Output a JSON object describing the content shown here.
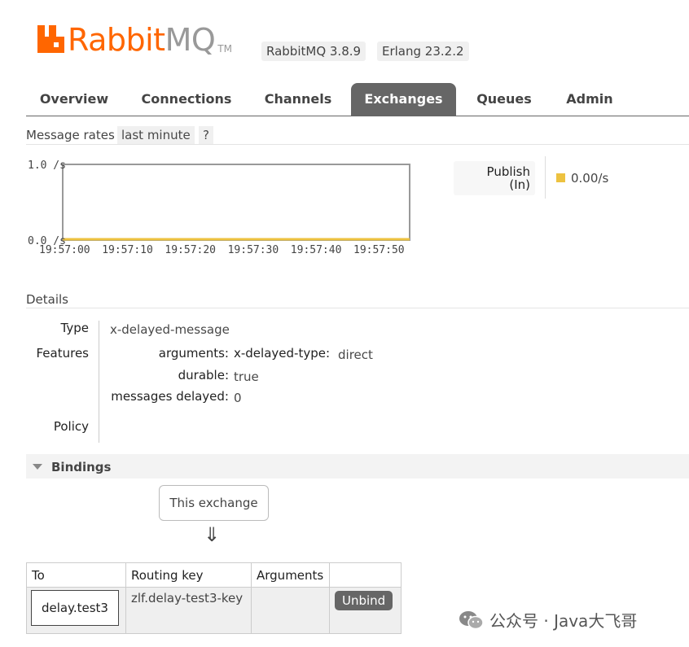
{
  "brand": {
    "name_a": "Rabbit",
    "name_b": "MQ",
    "tm": "TM"
  },
  "versions": {
    "rabbitmq": "RabbitMQ 3.8.9",
    "erlang": "Erlang 23.2.2"
  },
  "tabs": [
    {
      "label": "Overview"
    },
    {
      "label": "Connections"
    },
    {
      "label": "Channels"
    },
    {
      "label": "Exchanges",
      "active": true
    },
    {
      "label": "Queues"
    },
    {
      "label": "Admin"
    }
  ],
  "rates": {
    "title": "Message rates",
    "range": "last minute",
    "help": "?",
    "legend_label_1": "Publish",
    "legend_label_2": "(In)",
    "legend_value": "0.00/s",
    "legend_color": "#edc240"
  },
  "chart_data": {
    "type": "line",
    "x": [
      "19:57:00",
      "19:57:10",
      "19:57:20",
      "19:57:30",
      "19:57:40",
      "19:57:50"
    ],
    "series": [
      {
        "name": "Publish (In)",
        "values": [
          0,
          0,
          0,
          0,
          0,
          0
        ],
        "color": "#edc240"
      }
    ],
    "ylim": [
      0,
      1.0
    ],
    "yticks": [
      "1.0 /s",
      "0.0 /s"
    ],
    "grid": false
  },
  "details": {
    "title": "Details",
    "type_label": "Type",
    "type_value": "x-delayed-message",
    "features_label": "Features",
    "arguments_label": "arguments:",
    "arg_key": "x-delayed-type:",
    "arg_value": "direct",
    "durable_label": "durable:",
    "durable_value": "true",
    "delayed_label": "messages delayed:",
    "delayed_value": "0",
    "policy_label": "Policy"
  },
  "bindings": {
    "title": "Bindings",
    "this_exchange": "This exchange",
    "arrow": "⇓",
    "columns": [
      "To",
      "Routing key",
      "Arguments",
      ""
    ],
    "rows": [
      {
        "to": "delay.test3",
        "routing_key": "zlf.delay-test3-key",
        "arguments": "",
        "action": "Unbind"
      }
    ]
  },
  "watermark": {
    "text": "公众号 · Java大飞哥"
  }
}
